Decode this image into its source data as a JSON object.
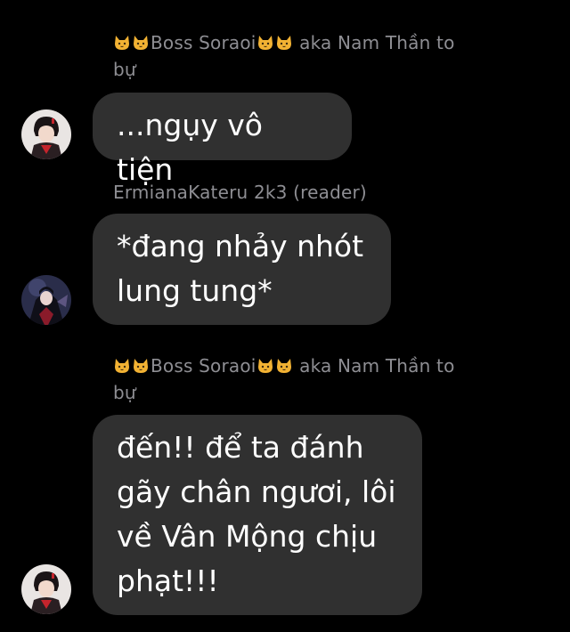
{
  "conversation": {
    "messages": [
      {
        "sender_prefix_emoji": "cat-face-icon cat-face-icon",
        "sender_name": "Boss Soraoi",
        "sender_suffix_emoji": "cat-face-icon cat-face-icon",
        "sender_tail": " aka Nam Thần to",
        "sender_tail2": "bự",
        "text": "...ngụy vô tiện",
        "avatar": "avatar-red-robed-character"
      },
      {
        "sender_name": "ErmianaKateru 2k3 (reader)",
        "text_line1": "*đang nhảy nhót",
        "text_line2": "lung tung*",
        "avatar": "avatar-dark-caped-character"
      },
      {
        "sender_prefix_emoji": "cat-face-icon cat-face-icon",
        "sender_name": "Boss Soraoi",
        "sender_suffix_emoji": "cat-face-icon cat-face-icon",
        "sender_tail": " aka Nam Thần to",
        "sender_tail2": "bự",
        "text_line1": "đến!! để ta đánh",
        "text_line2": "gãy chân ngươi, lôi",
        "text_line3": "về Vân Mộng chịu",
        "text_line4": "phạt!!!",
        "avatar": "avatar-red-robed-character"
      }
    ]
  },
  "colors": {
    "background": "#000000",
    "bubble": "#303030",
    "sender_text": "#8e8e93",
    "message_text": "#ffffff"
  }
}
